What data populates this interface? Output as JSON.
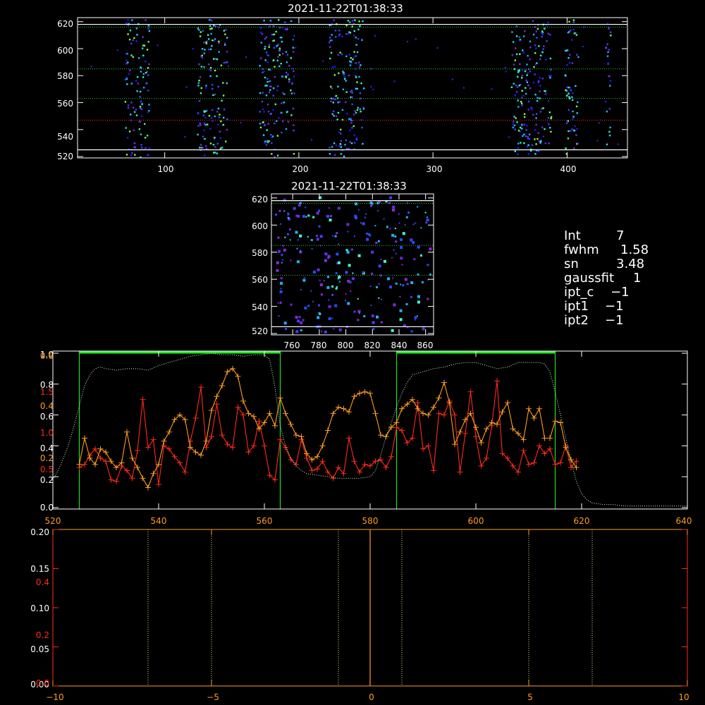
{
  "chart_data": [
    {
      "id": "top_image",
      "type": "heatmap",
      "title": "2021-11-22T01:38:33",
      "x_ticks": [
        "100",
        "200",
        "300",
        "400"
      ],
      "y_ticks": [
        "520",
        "540",
        "560",
        "580",
        "600",
        "620"
      ],
      "xlim": [
        35,
        445
      ],
      "ylim": [
        519,
        623
      ],
      "guide_lines": {
        "white_solid": [
          525,
          618
        ],
        "green_dotted": [
          563,
          585,
          616
        ],
        "red_dotted": [
          547
        ]
      },
      "hot_columns": [
        [
          70,
          88
        ],
        [
          124,
          146
        ],
        [
          170,
          196
        ],
        [
          222,
          248
        ],
        [
          358,
          388
        ],
        [
          398,
          408
        ],
        [
          428,
          432
        ]
      ],
      "colors": [
        "#1a1aff",
        "#3050ff",
        "#5a2cff",
        "#7a2ad8",
        "#20b0ff",
        "#2ad2ff",
        "#30ffb0",
        "#80ff40"
      ]
    },
    {
      "id": "zoom_image",
      "type": "heatmap",
      "title": "2021-11-22T01:38:33",
      "x_ticks": [
        "760",
        "780",
        "800",
        "820",
        "840",
        "860"
      ],
      "y_ticks": [
        "520",
        "540",
        "560",
        "580",
        "600",
        "620"
      ],
      "xlim": [
        744,
        866
      ],
      "ylim": [
        519,
        623
      ],
      "guide_lines": {
        "white_solid": [
          525,
          618
        ],
        "green_dotted": [
          563,
          585,
          616
        ]
      },
      "colors": [
        "#4a3cff",
        "#6a2ae0",
        "#8a2ad8",
        "#2050ff",
        "#20b0ff",
        "#40ffe0"
      ]
    },
    {
      "id": "profile",
      "type": "line",
      "x_ticks": [
        "520",
        "540",
        "560",
        "580",
        "600",
        "620",
        "640"
      ],
      "xlim": [
        520,
        640
      ],
      "y_ticks_white": [
        "0.0",
        "0.2",
        "0.4",
        "0.6",
        "0.8",
        "1.0"
      ],
      "ylim_white": [
        0,
        1.0
      ],
      "y_ticks_red": [
        "0.5",
        "1.0",
        "1.5"
      ],
      "y_ticks_orange": [
        "0.2",
        "0.4",
        "0.6"
      ],
      "green_boxes": [
        [
          525,
          563
        ],
        [
          585,
          615
        ]
      ],
      "series": [
        {
          "color": "#ff2a18",
          "x": [
            525,
            526,
            527,
            528,
            529,
            530,
            531,
            532,
            533,
            534,
            535,
            536,
            537,
            538,
            539,
            540,
            541,
            542,
            543,
            544,
            545,
            546,
            547,
            548,
            549,
            550,
            551,
            552,
            553,
            554,
            555,
            556,
            557,
            558,
            559,
            560,
            561,
            562,
            563,
            564,
            565,
            566,
            567,
            568,
            569,
            570,
            571,
            572,
            573,
            574,
            575,
            576,
            577,
            578,
            579,
            580,
            581,
            582,
            583,
            584,
            585,
            586,
            587,
            588,
            589,
            590,
            591,
            592,
            593,
            594,
            595,
            596,
            597,
            598,
            599,
            600,
            601,
            602,
            603,
            604,
            605,
            606,
            607,
            608,
            609,
            610,
            611,
            612,
            613,
            614,
            615,
            616,
            617,
            618,
            619
          ],
          "y": [
            0.26,
            0.28,
            0.34,
            0.38,
            0.32,
            0.3,
            0.18,
            0.17,
            0.27,
            0.24,
            0.19,
            0.37,
            0.7,
            0.39,
            0.44,
            0.15,
            0.4,
            0.38,
            0.33,
            0.29,
            0.23,
            0.43,
            0.58,
            0.78,
            0.39,
            0.46,
            0.67,
            0.47,
            0.41,
            0.39,
            0.65,
            0.6,
            0.36,
            0.4,
            0.56,
            0.4,
            0.21,
            0.18,
            0.44,
            0.39,
            0.31,
            0.28,
            0.44,
            0.32,
            0.24,
            0.25,
            0.3,
            0.23,
            0.19,
            0.26,
            0.22,
            0.45,
            0.3,
            0.23,
            0.28,
            0.27,
            0.3,
            0.31,
            0.26,
            0.33,
            0.52,
            0.5,
            0.42,
            0.45,
            0.68,
            0.38,
            0.4,
            0.24,
            0.61,
            0.6,
            0.69,
            0.6,
            0.23,
            0.48,
            0.75,
            0.46,
            0.27,
            0.32,
            0.53,
            0.82,
            0.35,
            0.32,
            0.27,
            0.23,
            0.37,
            0.28,
            0.29,
            0.4,
            0.35,
            0.38,
            0.28,
            0.29,
            0.4,
            0.26,
            0.3
          ]
        },
        {
          "color": "#ff9c1e",
          "x": [
            525,
            526,
            527,
            528,
            529,
            530,
            531,
            532,
            533,
            534,
            535,
            536,
            537,
            538,
            539,
            540,
            541,
            542,
            543,
            544,
            545,
            546,
            547,
            548,
            549,
            550,
            551,
            552,
            553,
            554,
            555,
            556,
            557,
            558,
            559,
            560,
            561,
            562,
            563,
            564,
            565,
            566,
            567,
            568,
            569,
            570,
            571,
            572,
            573,
            574,
            575,
            576,
            577,
            578,
            579,
            580,
            581,
            582,
            583,
            584,
            585,
            586,
            587,
            588,
            589,
            590,
            591,
            592,
            593,
            594,
            595,
            596,
            597,
            598,
            599,
            600,
            601,
            602,
            603,
            604,
            605,
            606,
            607,
            608,
            609,
            610,
            611,
            612,
            613,
            614,
            615,
            616,
            617,
            618,
            619
          ],
          "y": [
            0.28,
            0.45,
            0.32,
            0.28,
            0.38,
            0.36,
            0.3,
            0.26,
            0.29,
            0.49,
            0.32,
            0.26,
            0.19,
            0.13,
            0.22,
            0.28,
            0.43,
            0.49,
            0.57,
            0.6,
            0.57,
            0.39,
            0.36,
            0.34,
            0.43,
            0.63,
            0.72,
            0.79,
            0.88,
            0.9,
            0.85,
            0.69,
            0.61,
            0.59,
            0.51,
            0.55,
            0.61,
            0.53,
            0.71,
            0.61,
            0.54,
            0.47,
            0.46,
            0.35,
            0.31,
            0.33,
            0.4,
            0.5,
            0.61,
            0.65,
            0.64,
            0.62,
            0.72,
            0.74,
            0.75,
            0.74,
            0.61,
            0.47,
            0.46,
            0.52,
            0.55,
            0.64,
            0.67,
            0.7,
            0.64,
            0.61,
            0.6,
            0.65,
            0.71,
            0.81,
            0.68,
            0.41,
            0.49,
            0.57,
            0.61,
            0.52,
            0.42,
            0.51,
            0.55,
            0.54,
            0.62,
            0.68,
            0.51,
            0.48,
            0.44,
            0.64,
            0.58,
            0.64,
            0.45,
            0.45,
            0.56,
            0.55,
            0.39,
            0.31,
            0.26
          ]
        },
        {
          "color": "#c8ffc8",
          "style": "dotted",
          "x": [
            520,
            521,
            522,
            523,
            524,
            525,
            526,
            527,
            528,
            529,
            530,
            532,
            534,
            536,
            538,
            540,
            542,
            544,
            546,
            548,
            550,
            552,
            554,
            556,
            558,
            560,
            561,
            562,
            563,
            564,
            565,
            566,
            567,
            568,
            570,
            572,
            574,
            576,
            578,
            580,
            581,
            582,
            583,
            584,
            585,
            586,
            587,
            588,
            590,
            592,
            594,
            596,
            598,
            600,
            602,
            604,
            606,
            608,
            610,
            612,
            613,
            614,
            615,
            616,
            617,
            618,
            619,
            620,
            621,
            622,
            624,
            626,
            628,
            630,
            632,
            634,
            636,
            638,
            640
          ],
          "y": [
            0.18,
            0.24,
            0.32,
            0.41,
            0.53,
            0.66,
            0.79,
            0.86,
            0.9,
            0.91,
            0.9,
            0.89,
            0.9,
            0.9,
            0.89,
            0.92,
            0.94,
            0.96,
            0.98,
            0.99,
            1.0,
            0.99,
            0.99,
            0.98,
            0.99,
            0.99,
            0.96,
            0.78,
            0.53,
            0.4,
            0.32,
            0.27,
            0.24,
            0.22,
            0.21,
            0.2,
            0.19,
            0.19,
            0.19,
            0.2,
            0.24,
            0.34,
            0.46,
            0.55,
            0.65,
            0.74,
            0.81,
            0.86,
            0.88,
            0.9,
            0.91,
            0.93,
            0.94,
            0.94,
            0.92,
            0.9,
            0.91,
            0.94,
            0.94,
            0.94,
            0.93,
            0.88,
            0.75,
            0.6,
            0.45,
            0.3,
            0.17,
            0.09,
            0.05,
            0.03,
            0.02,
            0.02,
            0.01,
            0.01,
            0.01,
            0.01,
            0.01,
            0.01,
            0.01
          ]
        }
      ]
    },
    {
      "id": "bottom",
      "type": "line",
      "x_ticks": [
        "−10",
        "−5",
        "0",
        "5",
        "10"
      ],
      "xlim": [
        -10,
        10
      ],
      "y_ticks_white": [
        "0.00",
        "0.05",
        "0.10",
        "0.15",
        "0.20"
      ],
      "ylim": [
        0,
        0.2
      ],
      "y_ticks_red": [
        "0.0",
        "0.2",
        "0.4"
      ],
      "vlines_dotted_yellow": [
        -7,
        -5,
        -1,
        1,
        5,
        7
      ],
      "vline_solid_orange": [
        0
      ]
    }
  ],
  "info": {
    "lines": [
      {
        "label": "Int",
        "value": "7"
      },
      {
        "label": "fwhm",
        "value": "1.58"
      },
      {
        "label": "sn",
        "value": "3.48"
      },
      {
        "label": "gaussfit",
        "value": "1"
      },
      {
        "label": "ipt_c",
        "value": "−1"
      },
      {
        "label": "ipt1",
        "value": "−1"
      },
      {
        "label": "ipt2",
        "value": "−1"
      }
    ]
  }
}
